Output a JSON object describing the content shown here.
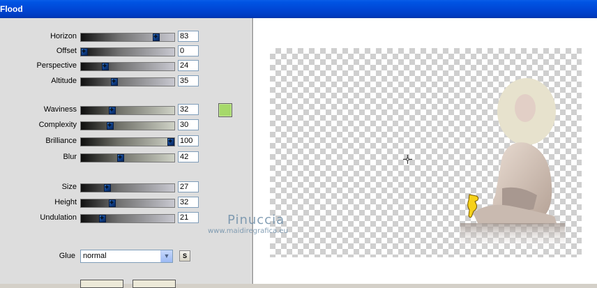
{
  "window": {
    "title": "Flood"
  },
  "sliders": [
    {
      "label": "Horizon",
      "value": "83",
      "level": 0.83,
      "style": "gray"
    },
    {
      "label": "Offset",
      "value": "0",
      "level": 0.0,
      "style": "gray"
    },
    {
      "label": "Perspective",
      "value": "24",
      "level": 0.24,
      "style": "gray"
    },
    {
      "label": "Altitude",
      "value": "35",
      "level": 0.35,
      "style": "gray"
    },
    {
      "label": "Waviness",
      "value": "32",
      "level": 0.32,
      "style": "green"
    },
    {
      "label": "Complexity",
      "value": "30",
      "level": 0.3,
      "style": "green"
    },
    {
      "label": "Brilliance",
      "value": "100",
      "level": 1.0,
      "style": "green"
    },
    {
      "label": "Blur",
      "value": "42",
      "level": 0.42,
      "style": "green"
    },
    {
      "label": "Size",
      "value": "27",
      "level": 0.27,
      "style": "gray"
    },
    {
      "label": "Height",
      "value": "32",
      "level": 0.32,
      "style": "gray"
    },
    {
      "label": "Undulation",
      "value": "21",
      "level": 0.21,
      "style": "gray"
    }
  ],
  "color_swatch": "#a6d96a",
  "glue": {
    "label": "Glue",
    "value": "normal",
    "s_button": "S"
  },
  "watermark": {
    "name": "Pinuccia",
    "url": "www.maidiregrafica.eu"
  }
}
